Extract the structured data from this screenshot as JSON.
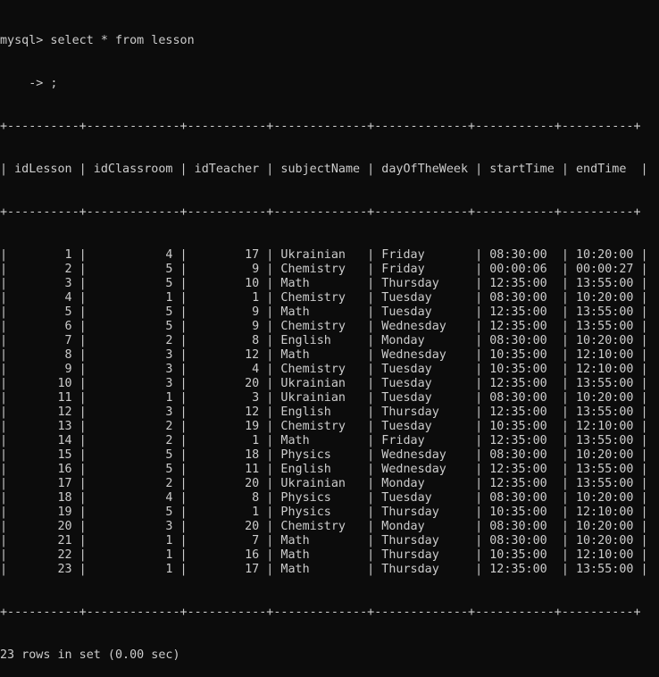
{
  "terminal": {
    "prompt_line": "mysql> select * from lesson",
    "continuation_line": "    -> ;",
    "border": "+----------+-------------+-----------+-------------+-------------+-----------+----------+",
    "header": "| idLesson | idClassroom | idTeacher | subjectName | dayOfTheWeek | startTime | endTime  |",
    "columns": [
      "idLesson",
      "idClassroom",
      "idTeacher",
      "subjectName",
      "dayOfTheWeek",
      "startTime",
      "endTime"
    ],
    "rows": [
      [
        "1",
        "4",
        "17",
        "Ukrainian",
        "Friday",
        "08:30:00",
        "10:20:00"
      ],
      [
        "2",
        "5",
        "9",
        "Chemistry",
        "Friday",
        "00:00:06",
        "00:00:27"
      ],
      [
        "3",
        "5",
        "10",
        "Math",
        "Thursday",
        "12:35:00",
        "13:55:00"
      ],
      [
        "4",
        "1",
        "1",
        "Chemistry",
        "Tuesday",
        "08:30:00",
        "10:20:00"
      ],
      [
        "5",
        "5",
        "9",
        "Math",
        "Tuesday",
        "12:35:00",
        "13:55:00"
      ],
      [
        "6",
        "5",
        "9",
        "Chemistry",
        "Wednesday",
        "12:35:00",
        "13:55:00"
      ],
      [
        "7",
        "2",
        "8",
        "English",
        "Monday",
        "08:30:00",
        "10:20:00"
      ],
      [
        "8",
        "3",
        "12",
        "Math",
        "Wednesday",
        "10:35:00",
        "12:10:00"
      ],
      [
        "9",
        "3",
        "4",
        "Chemistry",
        "Tuesday",
        "10:35:00",
        "12:10:00"
      ],
      [
        "10",
        "3",
        "20",
        "Ukrainian",
        "Tuesday",
        "12:35:00",
        "13:55:00"
      ],
      [
        "11",
        "1",
        "3",
        "Ukrainian",
        "Tuesday",
        "08:30:00",
        "10:20:00"
      ],
      [
        "12",
        "3",
        "12",
        "English",
        "Thursday",
        "12:35:00",
        "13:55:00"
      ],
      [
        "13",
        "2",
        "19",
        "Chemistry",
        "Tuesday",
        "10:35:00",
        "12:10:00"
      ],
      [
        "14",
        "2",
        "1",
        "Math",
        "Friday",
        "12:35:00",
        "13:55:00"
      ],
      [
        "15",
        "5",
        "18",
        "Physics",
        "Wednesday",
        "08:30:00",
        "10:20:00"
      ],
      [
        "16",
        "5",
        "11",
        "English",
        "Wednesday",
        "12:35:00",
        "13:55:00"
      ],
      [
        "17",
        "2",
        "20",
        "Ukrainian",
        "Monday",
        "12:35:00",
        "13:55:00"
      ],
      [
        "18",
        "4",
        "8",
        "Physics",
        "Tuesday",
        "08:30:00",
        "10:20:00"
      ],
      [
        "19",
        "5",
        "1",
        "Physics",
        "Thursday",
        "10:35:00",
        "12:10:00"
      ],
      [
        "20",
        "3",
        "20",
        "Chemistry",
        "Monday",
        "08:30:00",
        "10:20:00"
      ],
      [
        "21",
        "1",
        "7",
        "Math",
        "Thursday",
        "08:30:00",
        "10:20:00"
      ],
      [
        "22",
        "1",
        "16",
        "Math",
        "Thursday",
        "10:35:00",
        "12:10:00"
      ],
      [
        "23",
        "1",
        "17",
        "Math",
        "Thursday",
        "12:35:00",
        "13:55:00"
      ]
    ],
    "footer": "23 rows in set (0.00 sec)"
  },
  "colors": {
    "background": "#0c0c0c",
    "text": "#cccccc"
  }
}
